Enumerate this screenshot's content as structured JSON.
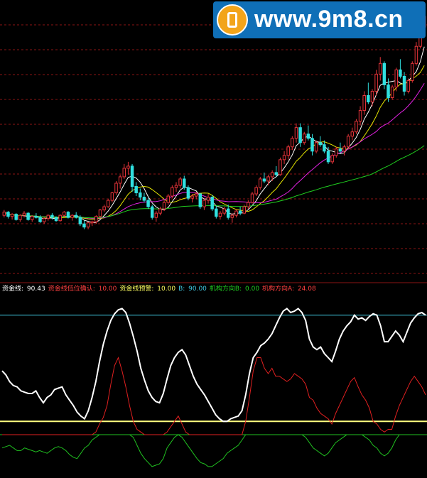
{
  "watermark": {
    "text": "www.9m8.cn"
  },
  "colors": {
    "background": "#000000",
    "grid": "#8b1414",
    "candle_up": "#e8343a",
    "candle_down": "#30e0e0",
    "ma_short": "#ffffff",
    "ma_mid": "#e6e600",
    "ma_long": "#e020e0",
    "ma_longest": "#20d020",
    "indicator_line": "#ffffff",
    "indicator_red": "#e02020",
    "indicator_green": "#20c020",
    "level_90": "#40c8e0",
    "level_10": "#ffff80"
  },
  "legend": [
    {
      "label": "资金线:",
      "value": "90.43",
      "color": "#ffffff"
    },
    {
      "label": "资金线低位确认:",
      "value": "10.00",
      "color": "#ff4040"
    },
    {
      "label": "资金线预警:",
      "value": "10.00",
      "color": "#ffff60"
    },
    {
      "label": "B:",
      "value": "90.00",
      "color": "#40c8e0"
    },
    {
      "label": "机构方向B:",
      "value": "0.00",
      "color": "#20d020"
    },
    {
      "label": "机构方向A:",
      "value": "24.08",
      "color": "#ff4040"
    }
  ],
  "chart_data": [
    {
      "type": "candlestick",
      "title": "",
      "grid": true,
      "candles": [
        [
          10.8,
          11.3,
          10.6,
          11.1
        ],
        [
          11.1,
          11.2,
          10.5,
          10.7
        ],
        [
          10.7,
          11.0,
          10.4,
          10.9
        ],
        [
          10.9,
          11.0,
          10.3,
          10.4
        ],
        [
          10.4,
          10.9,
          10.2,
          10.8
        ],
        [
          10.8,
          11.2,
          10.6,
          11.0
        ],
        [
          11.0,
          11.1,
          10.3,
          10.4
        ],
        [
          10.4,
          10.8,
          10.2,
          10.7
        ],
        [
          10.7,
          11.0,
          10.5,
          10.6
        ],
        [
          10.6,
          10.8,
          10.1,
          10.2
        ],
        [
          10.2,
          10.6,
          10.0,
          10.5
        ],
        [
          10.5,
          10.9,
          10.3,
          10.8
        ],
        [
          10.8,
          11.0,
          10.4,
          10.6
        ],
        [
          10.6,
          10.7,
          10.2,
          10.3
        ],
        [
          10.3,
          10.9,
          10.2,
          10.8
        ],
        [
          10.8,
          11.2,
          10.6,
          11.1
        ],
        [
          11.1,
          11.2,
          10.5,
          10.6
        ],
        [
          10.6,
          10.9,
          10.3,
          10.8
        ],
        [
          10.8,
          11.1,
          10.5,
          10.6
        ],
        [
          10.6,
          10.8,
          9.8,
          10.0
        ],
        [
          10.0,
          10.3,
          9.5,
          9.7
        ],
        [
          9.7,
          10.2,
          9.5,
          10.1
        ],
        [
          10.1,
          10.3,
          9.8,
          10.2
        ],
        [
          10.2,
          10.8,
          10.0,
          10.7
        ],
        [
          10.7,
          11.4,
          10.6,
          11.3
        ],
        [
          11.3,
          11.8,
          11.1,
          11.6
        ],
        [
          11.6,
          12.3,
          11.5,
          12.2
        ],
        [
          12.2,
          13.0,
          12.0,
          12.9
        ],
        [
          12.9,
          14.0,
          12.7,
          13.8
        ],
        [
          13.8,
          14.6,
          13.3,
          14.4
        ],
        [
          14.4,
          15.6,
          14.2,
          15.2
        ],
        [
          15.2,
          15.8,
          14.6,
          15.4
        ],
        [
          15.4,
          15.6,
          13.0,
          13.5
        ],
        [
          13.5,
          13.9,
          12.6,
          12.9
        ],
        [
          12.9,
          13.3,
          12.2,
          12.5
        ],
        [
          12.5,
          12.9,
          12.0,
          12.2
        ],
        [
          12.2,
          12.4,
          11.4,
          11.6
        ],
        [
          11.6,
          11.8,
          10.4,
          10.6
        ],
        [
          10.6,
          11.2,
          10.2,
          11.0
        ],
        [
          11.0,
          11.6,
          10.8,
          11.4
        ],
        [
          11.4,
          12.2,
          11.2,
          12.0
        ],
        [
          12.0,
          12.8,
          11.8,
          12.6
        ],
        [
          12.6,
          13.6,
          12.4,
          13.4
        ],
        [
          13.4,
          13.9,
          13.0,
          13.6
        ],
        [
          13.6,
          14.4,
          13.3,
          14.2
        ],
        [
          14.2,
          14.5,
          13.2,
          13.4
        ],
        [
          13.4,
          13.6,
          12.2,
          12.4
        ],
        [
          12.4,
          12.8,
          12.0,
          12.6
        ],
        [
          12.6,
          13.0,
          12.3,
          12.8
        ],
        [
          12.8,
          12.9,
          11.4,
          11.6
        ],
        [
          11.6,
          12.4,
          11.3,
          12.2
        ],
        [
          12.2,
          12.8,
          11.9,
          12.5
        ],
        [
          12.5,
          12.7,
          11.2,
          11.4
        ],
        [
          11.4,
          11.7,
          10.5,
          10.7
        ],
        [
          10.7,
          11.2,
          10.4,
          11.0
        ],
        [
          11.0,
          11.6,
          10.8,
          11.4
        ],
        [
          11.4,
          11.8,
          10.4,
          10.6
        ],
        [
          10.6,
          11.0,
          10.1,
          10.8
        ],
        [
          10.8,
          11.4,
          10.6,
          11.2
        ],
        [
          11.2,
          11.6,
          10.8,
          11.0
        ],
        [
          11.0,
          11.8,
          10.9,
          11.6
        ],
        [
          11.6,
          12.2,
          11.4,
          12.0
        ],
        [
          12.0,
          13.0,
          11.9,
          12.8
        ],
        [
          12.8,
          13.6,
          12.6,
          13.4
        ],
        [
          13.4,
          14.4,
          13.2,
          14.2
        ],
        [
          14.2,
          14.8,
          13.8,
          14.0
        ],
        [
          14.0,
          14.6,
          13.6,
          14.4
        ],
        [
          14.4,
          15.0,
          14.0,
          14.8
        ],
        [
          14.8,
          15.4,
          14.4,
          14.6
        ],
        [
          14.6,
          16.2,
          14.5,
          16.0
        ],
        [
          16.0,
          16.8,
          15.6,
          16.4
        ],
        [
          16.4,
          17.4,
          16.0,
          17.2
        ],
        [
          17.2,
          18.2,
          16.9,
          18.0
        ],
        [
          18.0,
          19.4,
          17.6,
          19.0
        ],
        [
          19.0,
          19.4,
          17.2,
          17.6
        ],
        [
          17.6,
          18.6,
          17.4,
          18.4
        ],
        [
          18.4,
          19.2,
          17.8,
          18.0
        ],
        [
          18.0,
          18.4,
          16.4,
          16.8
        ],
        [
          16.8,
          17.8,
          16.6,
          17.6
        ],
        [
          17.6,
          18.2,
          17.2,
          17.4
        ],
        [
          17.4,
          17.8,
          16.6,
          16.8
        ],
        [
          16.8,
          17.2,
          15.6,
          15.8
        ],
        [
          15.8,
          16.6,
          15.6,
          16.4
        ],
        [
          16.4,
          17.2,
          16.2,
          17.0
        ],
        [
          17.0,
          17.6,
          16.6,
          16.8
        ],
        [
          16.8,
          17.4,
          16.4,
          17.2
        ],
        [
          17.2,
          18.4,
          17.0,
          18.2
        ],
        [
          18.2,
          19.0,
          17.8,
          18.6
        ],
        [
          18.6,
          19.8,
          18.4,
          19.6
        ],
        [
          19.6,
          21.0,
          19.2,
          20.6
        ],
        [
          20.6,
          22.4,
          20.2,
          22.0
        ],
        [
          22.0,
          23.2,
          21.2,
          21.4
        ],
        [
          21.4,
          22.6,
          21.0,
          22.4
        ],
        [
          22.4,
          24.4,
          22.0,
          24.0
        ],
        [
          24.0,
          25.6,
          23.4,
          25.0
        ],
        [
          25.0,
          25.2,
          22.6,
          23.0
        ],
        [
          23.0,
          23.6,
          21.4,
          21.8
        ],
        [
          21.8,
          23.0,
          21.6,
          22.8
        ],
        [
          22.8,
          24.6,
          22.4,
          24.4
        ],
        [
          24.4,
          25.4,
          23.6,
          23.8
        ],
        [
          23.8,
          24.2,
          22.0,
          22.4
        ],
        [
          22.4,
          23.6,
          22.2,
          23.4
        ],
        [
          23.4,
          25.2,
          23.2,
          25.0
        ],
        [
          25.0,
          27.0,
          24.8,
          26.6
        ],
        [
          26.6,
          28.8,
          26.4,
          28.4
        ],
        [
          28.4,
          30.0,
          27.6,
          29.4
        ]
      ],
      "moving_averages": [
        {
          "period": 5,
          "color": "#ffffff"
        },
        {
          "period": 10,
          "color": "#e6e600"
        },
        {
          "period": 20,
          "color": "#e020e0"
        },
        {
          "period": 60,
          "color": "#20d020"
        }
      ]
    },
    {
      "type": "line",
      "title": "",
      "ylim": [
        0,
        100
      ],
      "grid": false,
      "hlines": [
        {
          "value": 90,
          "color": "#40c8e0"
        },
        {
          "value": 10,
          "color": "#ffff80"
        }
      ],
      "series": [
        {
          "name": "资金线",
          "color": "#ffffff",
          "values": [
            48,
            45,
            40,
            37,
            36,
            33,
            32,
            31,
            31,
            33,
            28,
            24,
            28,
            30,
            34,
            35,
            36,
            30,
            26,
            22,
            17,
            14,
            12,
            18,
            28,
            40,
            55,
            68,
            78,
            86,
            91,
            94,
            95,
            92,
            84,
            74,
            63,
            50,
            41,
            33,
            28,
            25,
            24,
            31,
            42,
            52,
            58,
            62,
            64,
            60,
            52,
            44,
            38,
            34,
            30,
            25,
            20,
            15,
            12,
            10,
            10,
            12,
            13,
            14,
            18,
            30,
            46,
            58,
            62,
            67,
            69,
            72,
            76,
            82,
            88,
            93,
            95,
            92,
            93,
            95,
            92,
            86,
            72,
            66,
            64,
            66,
            61,
            58,
            55,
            63,
            72,
            78,
            82,
            85,
            90,
            87,
            88,
            86,
            89,
            91,
            90,
            82,
            70,
            70,
            74,
            78,
            75,
            70,
            77,
            84,
            88,
            91,
            92,
            90
          ]
        },
        {
          "name": "机构方向A",
          "color": "#e02020",
          "values": [
            0,
            0,
            0,
            0,
            0,
            0,
            0,
            0,
            0,
            0,
            0,
            0,
            0,
            0,
            0,
            0,
            0,
            0,
            0,
            0,
            0,
            0,
            0,
            0,
            0,
            2,
            8,
            13,
            22,
            38,
            52,
            58,
            48,
            36,
            22,
            10,
            4,
            2,
            0,
            0,
            0,
            0,
            0,
            0,
            2,
            6,
            10,
            14,
            8,
            2,
            0,
            0,
            0,
            0,
            0,
            0,
            0,
            0,
            0,
            0,
            0,
            0,
            0,
            0,
            0,
            10,
            28,
            48,
            58,
            58,
            50,
            46,
            50,
            44,
            44,
            42,
            40,
            42,
            46,
            44,
            42,
            38,
            28,
            26,
            20,
            16,
            14,
            12,
            8,
            16,
            22,
            28,
            34,
            40,
            43,
            36,
            30,
            26,
            20,
            10,
            8,
            4,
            2,
            4,
            4,
            14,
            22,
            28,
            34,
            40,
            44,
            40,
            36,
            30
          ]
        },
        {
          "name": "机构方向B",
          "color": "#20c020",
          "values": [
            -10,
            -9,
            -8,
            -10,
            -12,
            -12,
            -10,
            -11,
            -12,
            -13,
            -12,
            -13,
            -14,
            -12,
            -10,
            -9,
            -10,
            -12,
            -15,
            -17,
            -18,
            -14,
            -10,
            -8,
            -4,
            -2,
            0,
            0,
            0,
            0,
            0,
            0,
            0,
            0,
            0,
            -2,
            -8,
            -14,
            -18,
            -21,
            -24,
            -23,
            -22,
            -18,
            -10,
            -6,
            -2,
            0,
            -2,
            -6,
            -10,
            -14,
            -18,
            -21,
            -22,
            -24,
            -24,
            -22,
            -20,
            -18,
            -14,
            -12,
            -10,
            -8,
            -4,
            0,
            0,
            0,
            0,
            0,
            0,
            0,
            0,
            0,
            0,
            0,
            0,
            0,
            0,
            0,
            0,
            -2,
            -6,
            -10,
            -12,
            -14,
            -16,
            -14,
            -10,
            -6,
            -4,
            -2,
            0,
            0,
            0,
            0,
            0,
            -2,
            -4,
            -8,
            -10,
            -14,
            -16,
            -14,
            -10,
            -4,
            0,
            0,
            0,
            0,
            0,
            0,
            0,
            0
          ]
        }
      ]
    }
  ]
}
